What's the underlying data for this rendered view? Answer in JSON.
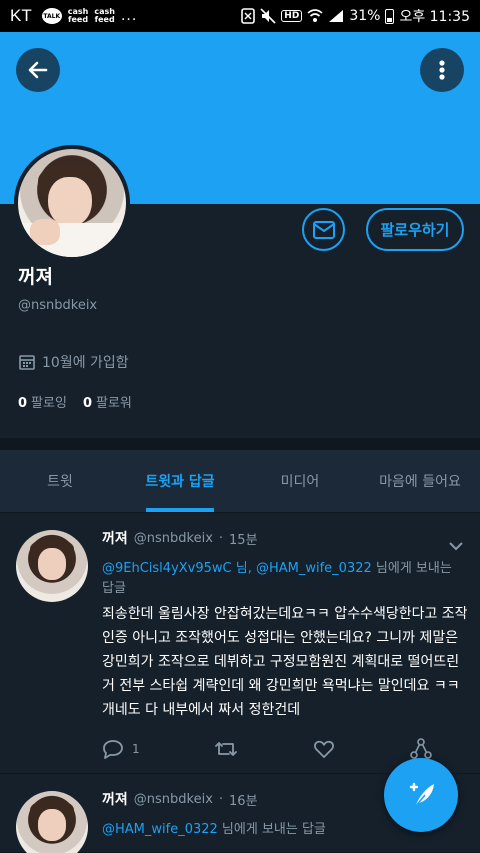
{
  "status_bar": {
    "carrier": "KT",
    "talk": "TALK",
    "cashfeed_1": [
      "cash",
      "feed"
    ],
    "cashfeed_2": [
      "cash",
      "feed"
    ],
    "more": "...",
    "hd": "HD",
    "battery": "31%",
    "time": "오후 11:35"
  },
  "profile": {
    "display_name": "꺼져",
    "handle": "@nsnbdkeix",
    "joined": "10월에 가입함",
    "following_count": "0",
    "following_label": "팔로잉",
    "followers_count": "0",
    "followers_label": "팔로워",
    "follow_button": "팔로우하기"
  },
  "tabs": [
    {
      "label": "트윗",
      "active": false
    },
    {
      "label": "트윗과 답글",
      "active": true
    },
    {
      "label": "미디어",
      "active": false
    },
    {
      "label": "마음에 들어요",
      "active": false
    }
  ],
  "tweets": [
    {
      "name": "꺼져",
      "handle": "@nsnbdkeix",
      "dot": "·",
      "time": "15분",
      "reply_mentions": "@9EhCisl4yXv95wC 님, @HAM_wife_0322",
      "reply_suffix": " 님에게 보내는 답글",
      "body": "죄송한데 울림사장 안잡혀갔는데요ㅋㅋ 압수수색당한다고 조작인증 아니고 조작했어도 성접대는 안했는데요? 그니까 제말은 강민희가 조작으로 데뷔하고 구정모함원진 계획대로 떨어뜨린거 전부 스타쉽 계략인데 왜 강민희만 욕먹냐는 말인데요 ㅋㅋ 개네도 다 내부에서 짜서 정한건데",
      "reply_count": "1"
    },
    {
      "name": "꺼져",
      "handle": "@nsnbdkeix",
      "dot": "·",
      "time": "16분",
      "reply_mentions": "@HAM_wife_0322",
      "reply_suffix": " 님에게 보내는 답글"
    }
  ],
  "icons": {
    "back": "arrow-left-icon",
    "more": "more-vertical-icon",
    "message": "envelope-icon",
    "calendar": "calendar-icon",
    "reply": "reply-icon",
    "retweet": "retweet-icon",
    "like": "heart-icon",
    "share": "share-icon",
    "compose": "compose-feather-icon"
  },
  "colors": {
    "accent": "#1da1f2",
    "background": "#15202b",
    "secondary_text": "#8899a6"
  }
}
